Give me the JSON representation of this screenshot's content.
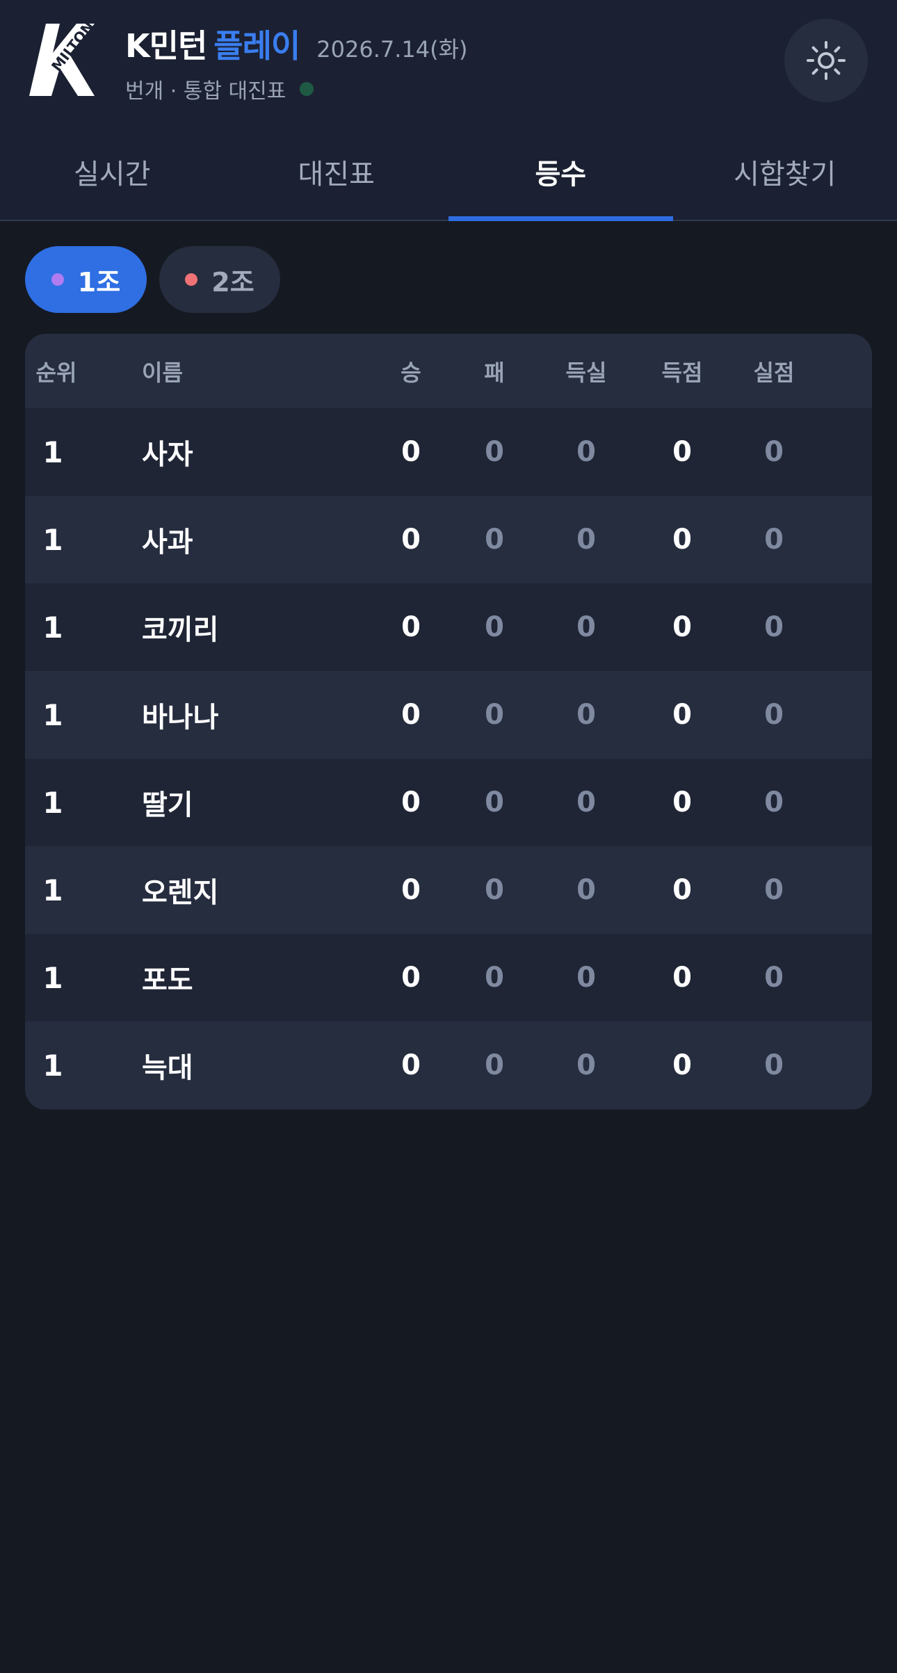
{
  "header": {
    "logo_text": "MILTON",
    "app_name": "K민턴",
    "app_name_accent": "플레이",
    "date": "2026.7.14(화)",
    "subtitle": "번개 · 통합 대진표",
    "accent_color": "#3a7ef0",
    "settings_icon": "gear-icon"
  },
  "tabs": [
    {
      "label": "실시간",
      "active": false
    },
    {
      "label": "대진표",
      "active": false
    },
    {
      "label": "등수",
      "active": true
    },
    {
      "label": "시합찾기",
      "active": false
    }
  ],
  "groups": [
    {
      "label": "1조",
      "dot_color": "#b07cf0",
      "selected": true
    },
    {
      "label": "2조",
      "dot_color": "#f07277",
      "selected": false
    }
  ],
  "standings": {
    "columns": [
      "순위",
      "이름",
      "승",
      "패",
      "득실",
      "득점",
      "실점"
    ],
    "rows": [
      {
        "rank": "1",
        "name": "사자",
        "win": "0",
        "loss": "0",
        "diff": "0",
        "scored": "0",
        "conceded": "0"
      },
      {
        "rank": "1",
        "name": "사과",
        "win": "0",
        "loss": "0",
        "diff": "0",
        "scored": "0",
        "conceded": "0"
      },
      {
        "rank": "1",
        "name": "코끼리",
        "win": "0",
        "loss": "0",
        "diff": "0",
        "scored": "0",
        "conceded": "0"
      },
      {
        "rank": "1",
        "name": "바나나",
        "win": "0",
        "loss": "0",
        "diff": "0",
        "scored": "0",
        "conceded": "0"
      },
      {
        "rank": "1",
        "name": "딸기",
        "win": "0",
        "loss": "0",
        "diff": "0",
        "scored": "0",
        "conceded": "0"
      },
      {
        "rank": "1",
        "name": "오렌지",
        "win": "0",
        "loss": "0",
        "diff": "0",
        "scored": "0",
        "conceded": "0"
      },
      {
        "rank": "1",
        "name": "포도",
        "win": "0",
        "loss": "0",
        "diff": "0",
        "scored": "0",
        "conceded": "0"
      },
      {
        "rank": "1",
        "name": "늑대",
        "win": "0",
        "loss": "0",
        "diff": "0",
        "scored": "0",
        "conceded": "0"
      }
    ]
  }
}
